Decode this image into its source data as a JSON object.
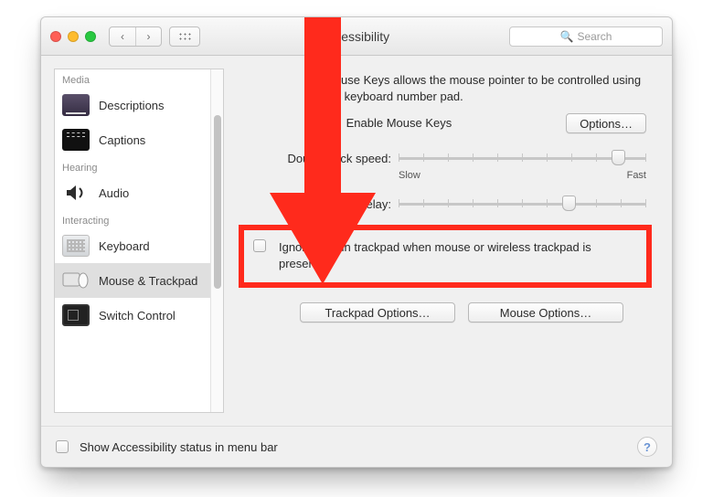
{
  "window": {
    "title": "Accessibility"
  },
  "search": {
    "placeholder": "Search"
  },
  "sidebar": {
    "groups": [
      {
        "label": "Media",
        "items": [
          {
            "label": "Descriptions"
          },
          {
            "label": "Captions"
          }
        ]
      },
      {
        "label": "Hearing",
        "items": [
          {
            "label": "Audio"
          }
        ]
      },
      {
        "label": "Interacting",
        "items": [
          {
            "label": "Keyboard"
          },
          {
            "label": "Mouse & Trackpad"
          },
          {
            "label": "Switch Control"
          }
        ]
      }
    ]
  },
  "panel": {
    "intro": "Mouse Keys allows the mouse pointer to be controlled using the keyboard number pad.",
    "enable_label": "Enable Mouse Keys",
    "options_button": "Options…",
    "dblclick_label": "Double-click speed:",
    "spring_label": "Spring-loading delay:",
    "slow": "Slow",
    "fast": "Fast",
    "ignore_label": "Ignore built-in trackpad when mouse or wireless trackpad is present",
    "trackpad_options": "Trackpad Options…",
    "mouse_options": "Mouse Options…"
  },
  "footer": {
    "status_label": "Show Accessibility status in menu bar",
    "help": "?"
  }
}
